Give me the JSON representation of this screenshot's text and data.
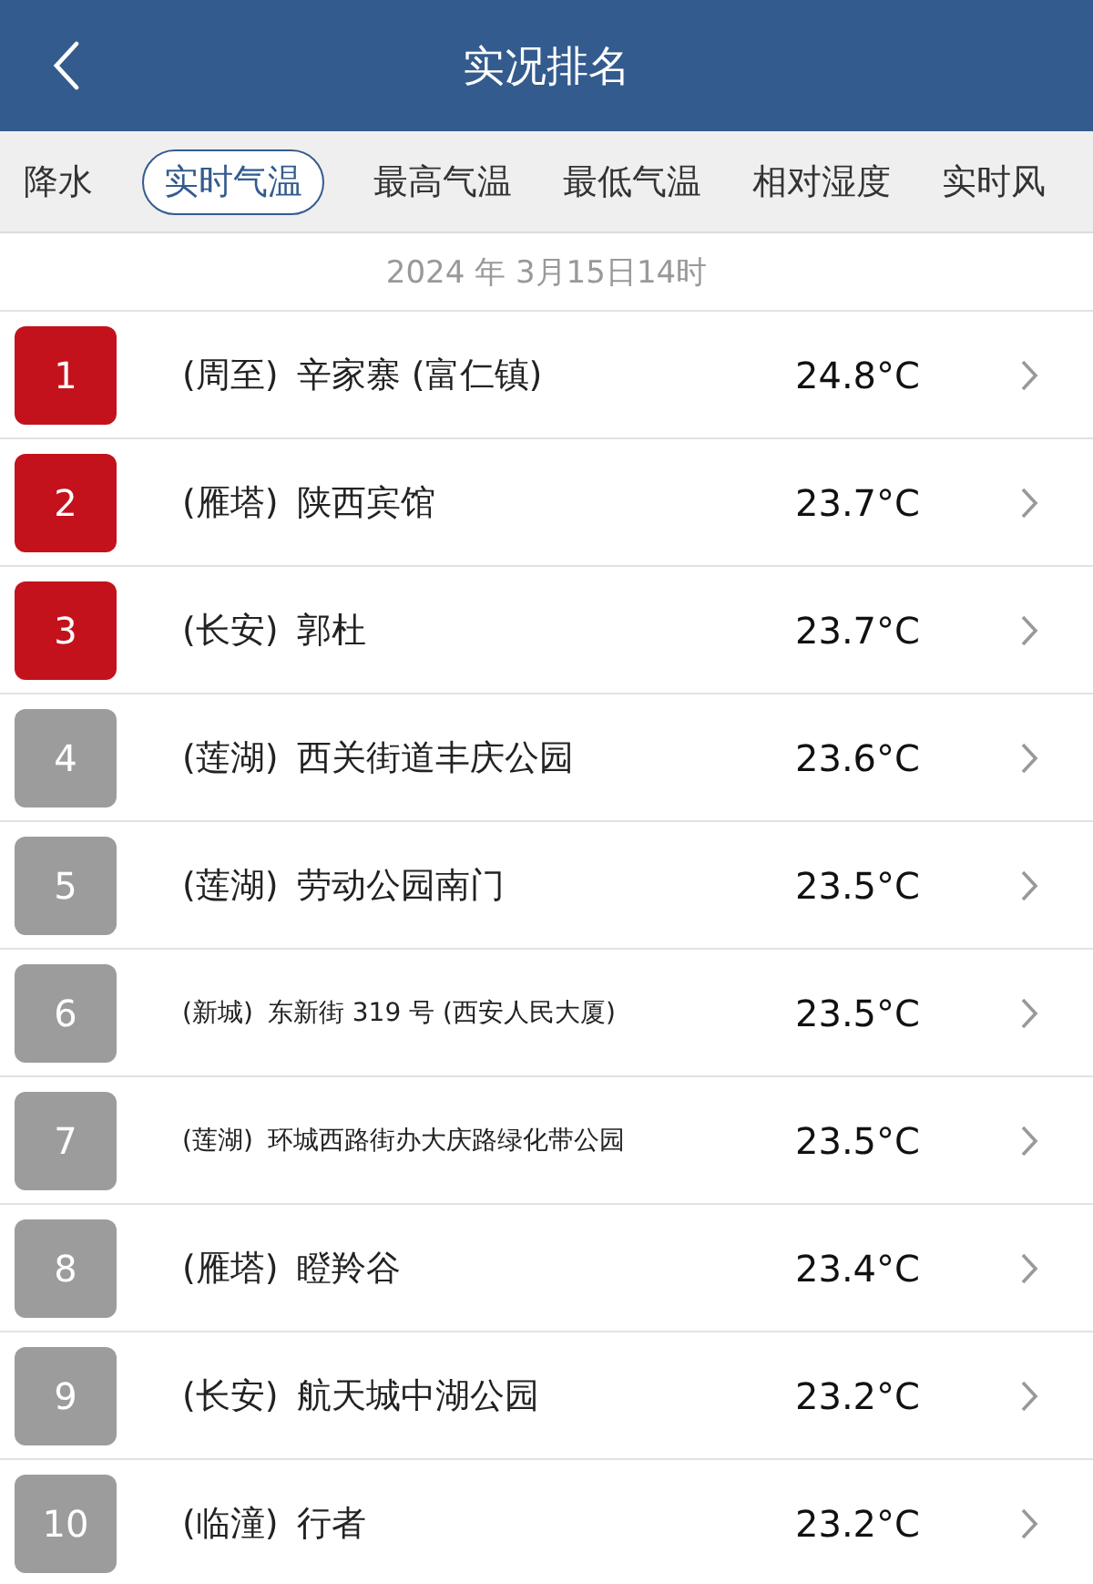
{
  "header": {
    "title": "实况排名"
  },
  "tabs": [
    {
      "label": "降水",
      "selected": false
    },
    {
      "label": "实时气温",
      "selected": true
    },
    {
      "label": "最高气温",
      "selected": false
    },
    {
      "label": "最低气温",
      "selected": false
    },
    {
      "label": "相对湿度",
      "selected": false
    },
    {
      "label": "实时风",
      "selected": false
    }
  ],
  "date": "2024 年 3月15日14时",
  "rows": [
    {
      "rank": "1",
      "color": "#c4121c",
      "region": "(周至)",
      "place": "辛家寨 (富仁镇)",
      "temp": "24.8°C",
      "kind": "normal"
    },
    {
      "rank": "2",
      "color": "#c4121c",
      "region": "(雁塔)",
      "place": "陕西宾馆",
      "temp": "23.7°C",
      "kind": "normal"
    },
    {
      "rank": "3",
      "color": "#c4121c",
      "region": "(长安)",
      "place": "郭杜",
      "temp": "23.7°C",
      "kind": "normal"
    },
    {
      "rank": "4",
      "color": "#9c9c9c",
      "region": "(莲湖)",
      "place": "西关街道丰庆公园",
      "temp": "23.6°C",
      "kind": "normal"
    },
    {
      "rank": "5",
      "color": "#9c9c9c",
      "region": "(莲湖)",
      "place": "劳动公园南门",
      "temp": "23.5°C",
      "kind": "normal"
    },
    {
      "rank": "6",
      "color": "#9c9c9c",
      "region": "(新城)",
      "place": "东新街 319 号 (西安人民大厦)",
      "temp": "23.5°C",
      "kind": "compact"
    },
    {
      "rank": "7",
      "color": "#9c9c9c",
      "region": "(莲湖)",
      "place": "环城西路街办大庆路绿化带公园",
      "temp": "23.5°C",
      "kind": "compact"
    },
    {
      "rank": "8",
      "color": "#9c9c9c",
      "region": "(雁塔)",
      "place": "瞪羚谷",
      "temp": "23.4°C",
      "kind": "normal"
    },
    {
      "rank": "9",
      "color": "#9c9c9c",
      "region": "(长安)",
      "place": "航天城中湖公园",
      "temp": "23.2°C",
      "kind": "normal"
    },
    {
      "rank": "10",
      "color": "#9c9c9c",
      "region": "(临潼)",
      "place": "行者",
      "temp": "23.2°C",
      "kind": "normal"
    }
  ]
}
